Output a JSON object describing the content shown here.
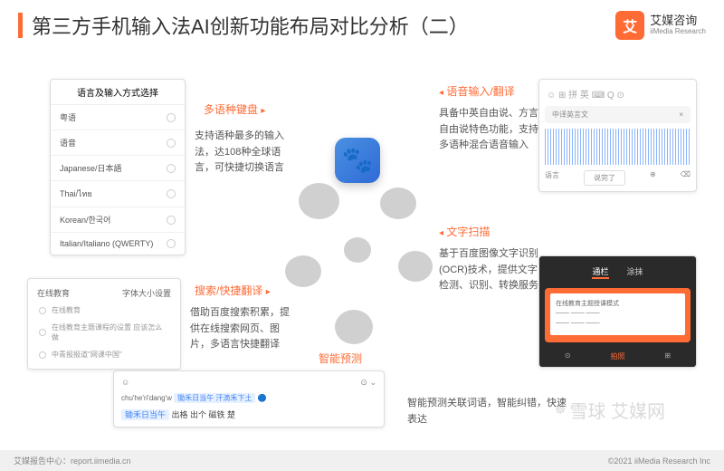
{
  "header": {
    "title": "第三方手机输入法AI创新功能布局对比分析（二）",
    "logo_cn": "艾媒咨询",
    "logo_en": "iiMedia Research",
    "logo_mark": "艾"
  },
  "panel_lang": {
    "header": "语言及输入方式选择",
    "items": [
      "粤语",
      "语音",
      "Japanese/日本語",
      "Thai/ไทย",
      "Korean/한국어",
      "Italian/Italiano (QWERTY)"
    ]
  },
  "panel_search": {
    "tab1": "在线教育",
    "tab2": "字体大小设置",
    "line1": "在线教育",
    "line2": "在线教育主题课程的设置 应该怎么做",
    "line3": "中青报报道\"网课中国\""
  },
  "panel_voice": {
    "icons": "☺  ⊞  拼  英  ⌨  Q  ⊙",
    "box_text": "中译英言文",
    "btn_left": "语言",
    "btn_mid": "说完了",
    "btn_r1": "⊕",
    "btn_r2": "⌫"
  },
  "panel_ocr": {
    "tab1": "通栏",
    "tab2": "涂抹",
    "banner": "在线教育主题授课模式",
    "btn1": "⊙",
    "btn2": "拍照",
    "btn3": "⊞"
  },
  "panel_input": {
    "pinyin": "chu'he'ri'dang'w",
    "suggest": "锄禾日当午 汗滴禾下土",
    "candidates": "出格  出个  磁铁  楚"
  },
  "features": {
    "f1": {
      "label": "多语种键盘",
      "desc": "支持语种最多的输入法，达108种全球语言，可快捷切换语言"
    },
    "f2": {
      "label": "搜索/快捷翻译",
      "desc": "借助百度搜索积累，提供在线搜索网页、图片，多语言快捷翻译"
    },
    "f3": {
      "label": "语音输入/翻译",
      "desc": "具备中英自由说、方言自由说特色功能，支持多语种混合语音输入"
    },
    "f4": {
      "label": "文字扫描",
      "desc": "基于百度图像文字识别(OCR)技术，提供文字检测、识别、转换服务"
    },
    "f5": {
      "label": "智能预测",
      "desc": "智能预测关联词语，智能纠错，快速表达"
    }
  },
  "footer": {
    "left": "艾媒报告中心：report.iimedia.cn",
    "right": "©2021 iiMedia Research Inc"
  },
  "watermark": "雪球 艾媒网"
}
